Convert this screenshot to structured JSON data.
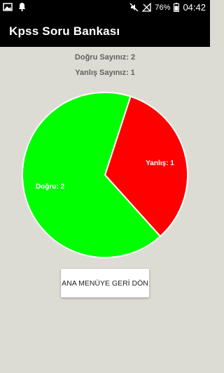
{
  "status_bar": {
    "battery": "76%",
    "time": "04:42"
  },
  "app": {
    "title": "Kpss Soru Bankası"
  },
  "stats": {
    "correct": "Doğru Sayınız: 2",
    "wrong": "Yanlış Sayınız: 1"
  },
  "chart_data": {
    "type": "pie",
    "slices": [
      {
        "label": "Yanlış: 1",
        "value": 1,
        "color": "#ff0000"
      },
      {
        "label": "Doğru: 2",
        "value": 2,
        "color": "#00ff00"
      }
    ]
  },
  "actions": {
    "main_menu": "ANA MENÜYE GERİ DÖN"
  }
}
